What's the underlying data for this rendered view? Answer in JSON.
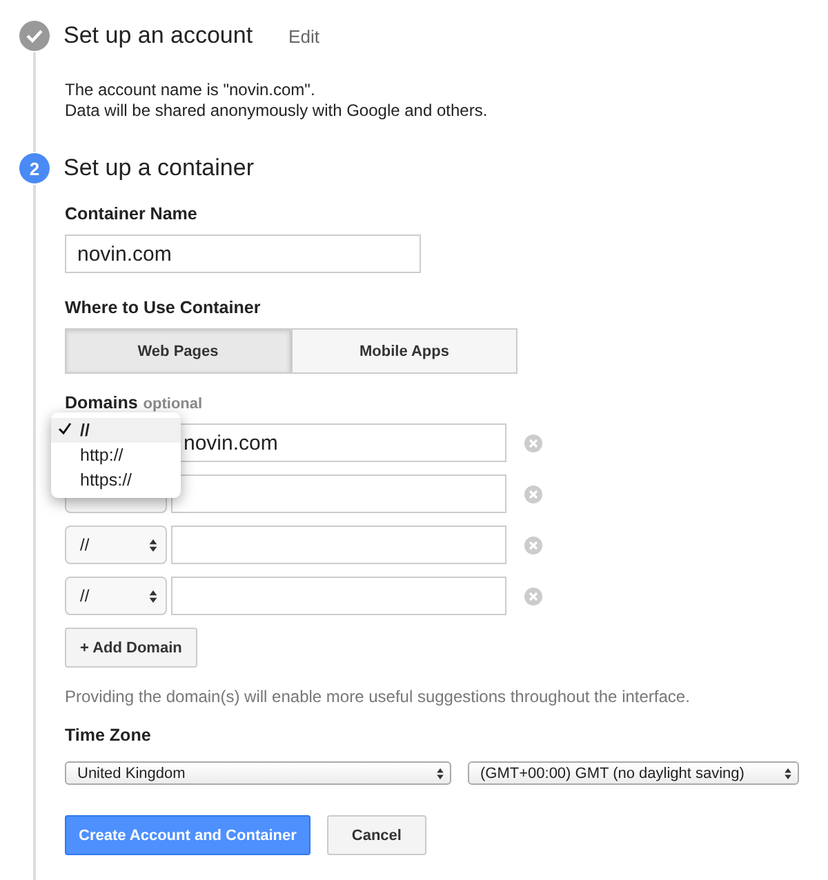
{
  "steps": [
    {
      "kind": "done",
      "title": "Set up an account",
      "edit_link": "Edit",
      "lines": [
        "The account name is \"novin.com\".",
        "Data will be shared anonymously with Google and others."
      ]
    },
    {
      "kind": "active",
      "number": "2",
      "title": "Set up a container"
    }
  ],
  "container_name": {
    "label": "Container Name",
    "value": "novin.com"
  },
  "where_to_use": {
    "label": "Where to Use Container",
    "options": [
      {
        "label": "Web Pages",
        "selected": true
      },
      {
        "label": "Mobile Apps",
        "selected": false
      }
    ]
  },
  "domains": {
    "label": "Domains",
    "hint": "optional",
    "rows": [
      {
        "value": "novin.com"
      },
      {
        "value": ""
      },
      {
        "protocol": "//",
        "value": ""
      },
      {
        "protocol": "//",
        "value": ""
      }
    ],
    "open_menu": [
      {
        "label": "//",
        "selected": true
      },
      {
        "label": "http://",
        "selected": false
      },
      {
        "label": "https://",
        "selected": false
      }
    ],
    "add_button": "+ Add Domain",
    "help": "Providing the domain(s) will enable more useful suggestions throughout the interface."
  },
  "time_zone": {
    "label": "Time Zone",
    "country": "United Kingdom",
    "zone": "(GMT+00:00) GMT (no daylight saving)"
  },
  "buttons": {
    "primary": "Create Account and Container",
    "cancel": "Cancel"
  }
}
